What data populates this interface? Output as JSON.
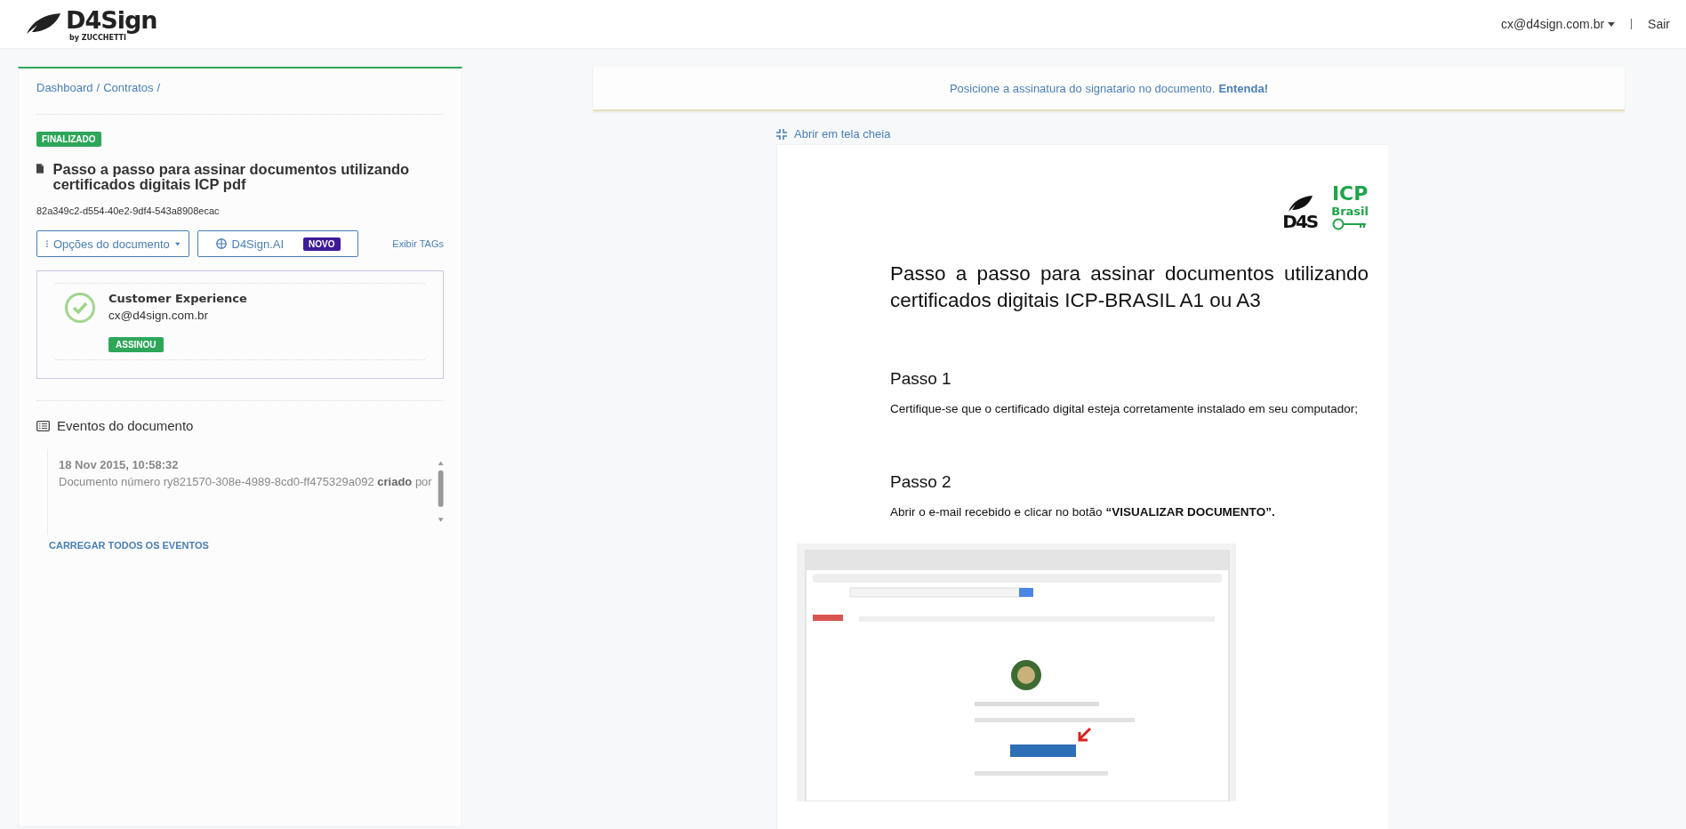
{
  "header": {
    "brand": "D4Sign",
    "brand_sub": "by ZUCCHETTI",
    "user_menu": "cx@d4sign.com.br",
    "logout": "Sair"
  },
  "breadcrumb": {
    "items": [
      "Dashboard",
      "Contratos"
    ],
    "separator": "/"
  },
  "document": {
    "status": "FINALIZADO",
    "title": "Passo a passo para assinar documentos utilizando certificados digitais ICP pdf",
    "id": "82a349c2-d554-40e2-9df4-543a8908ecac"
  },
  "actions": [
    {
      "kind": "dropdown",
      "label": "Opções do documento"
    },
    {
      "kind": "ai",
      "label": "D4Sign.AI",
      "badge": "NOVO"
    },
    {
      "kind": "link",
      "label": "Exibir TAGs"
    }
  ],
  "signers": [
    {
      "name": "Customer Experience",
      "email": "cx@d4sign.com.br",
      "status": "ASSINOU",
      "signed": true
    }
  ],
  "events": {
    "title": "Eventos do documento",
    "items": [
      {
        "time": "18 Nov 2015, 10:58:32",
        "text": "Documento número ry821570-308e-4989-8cd0-ff475329a092 **criado** por"
      }
    ],
    "load_all": "CARREGAR TODOS OS EVENTOS"
  },
  "notice": {
    "text": "Posicione a assinatura do signatario no documento.",
    "link": "Entenda!"
  },
  "viewer": {
    "fullscreen": "Abrir em tela cheia",
    "logos": [
      {
        "kind": "d4s",
        "text": "D4S"
      },
      {
        "kind": "icp",
        "text": "ICP",
        "subtext": "Brasil"
      }
    ],
    "title": "Passo a passo para assinar documentos utilizando certificados digitais ICP-BRASIL A1 ou A3",
    "sections": [
      {
        "heading": "Passo 1",
        "text": "Certifique-se que o certificado digital esteja corretamente instalado em seu computador;"
      },
      {
        "heading": "Passo 2",
        "text": "Abrir o e-mail recebido e clicar no botão **“VISUALIZAR DOCUMENTO”.**"
      }
    ]
  }
}
